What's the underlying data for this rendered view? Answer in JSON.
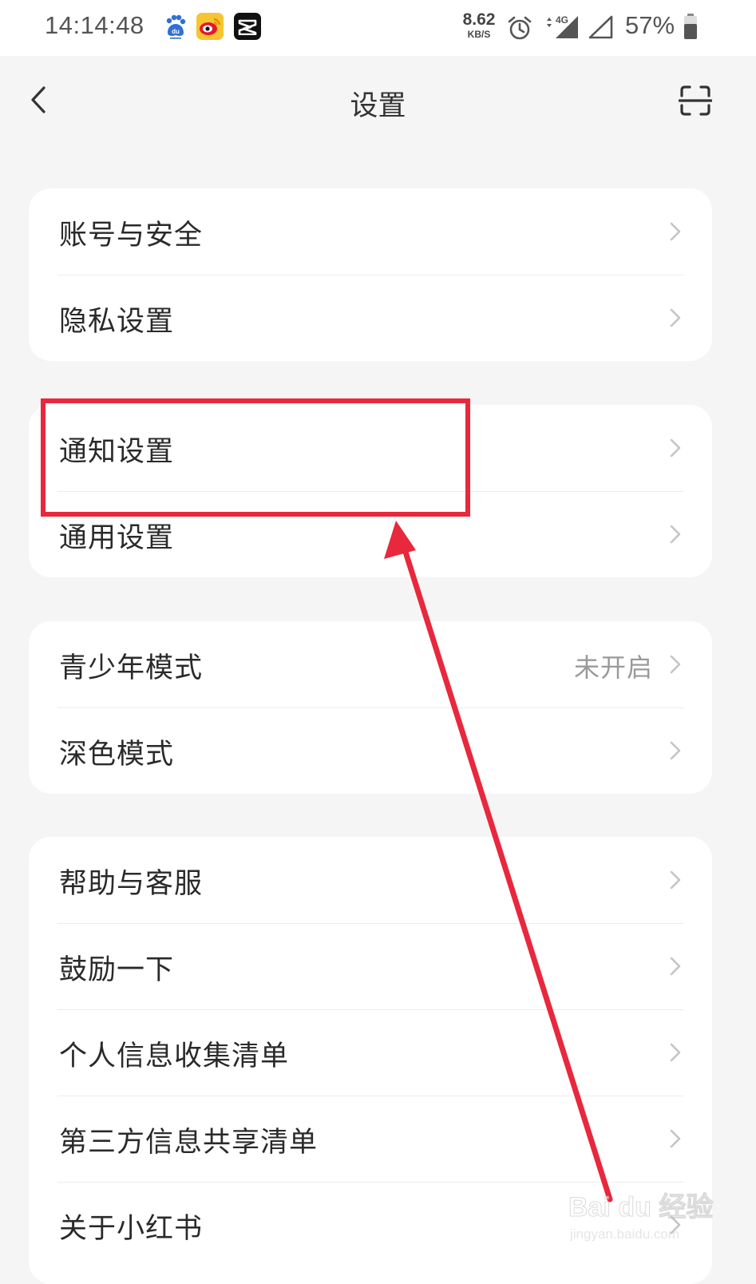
{
  "status_bar": {
    "time": "14:14:48",
    "net_speed_value": "8.62",
    "net_speed_unit": "KB/S",
    "network_type": "4G",
    "battery": "57%",
    "app_icons": [
      "baidu-icon",
      "weibo-icon",
      "capcut-icon"
    ]
  },
  "nav": {
    "title": "设置",
    "back_icon": "chevron-left-icon",
    "scan_icon": "scan-icon"
  },
  "groups": [
    {
      "items": [
        {
          "label": "账号与安全",
          "value": ""
        },
        {
          "label": "隐私设置",
          "value": ""
        }
      ]
    },
    {
      "items": [
        {
          "label": "通知设置",
          "value": ""
        },
        {
          "label": "通用设置",
          "value": ""
        }
      ]
    },
    {
      "items": [
        {
          "label": "青少年模式",
          "value": "未开启"
        },
        {
          "label": "深色模式",
          "value": ""
        }
      ]
    },
    {
      "items": [
        {
          "label": "帮助与客服",
          "value": ""
        },
        {
          "label": "鼓励一下",
          "value": ""
        },
        {
          "label": "个人信息收集清单",
          "value": ""
        },
        {
          "label": "第三方信息共享清单",
          "value": ""
        },
        {
          "label": "关于小红书",
          "value": ""
        }
      ]
    }
  ],
  "annotation": {
    "highlight_target": "通知设置",
    "color": "#e8283c"
  },
  "watermark": {
    "main": "Bai du 经验",
    "sub": "jingyan.baidu.com"
  },
  "colors": {
    "background": "#f5f5f5",
    "card": "#ffffff",
    "text": "#2a2a2a",
    "secondary_text": "#9a9a9a",
    "annotation": "#e8283c"
  }
}
